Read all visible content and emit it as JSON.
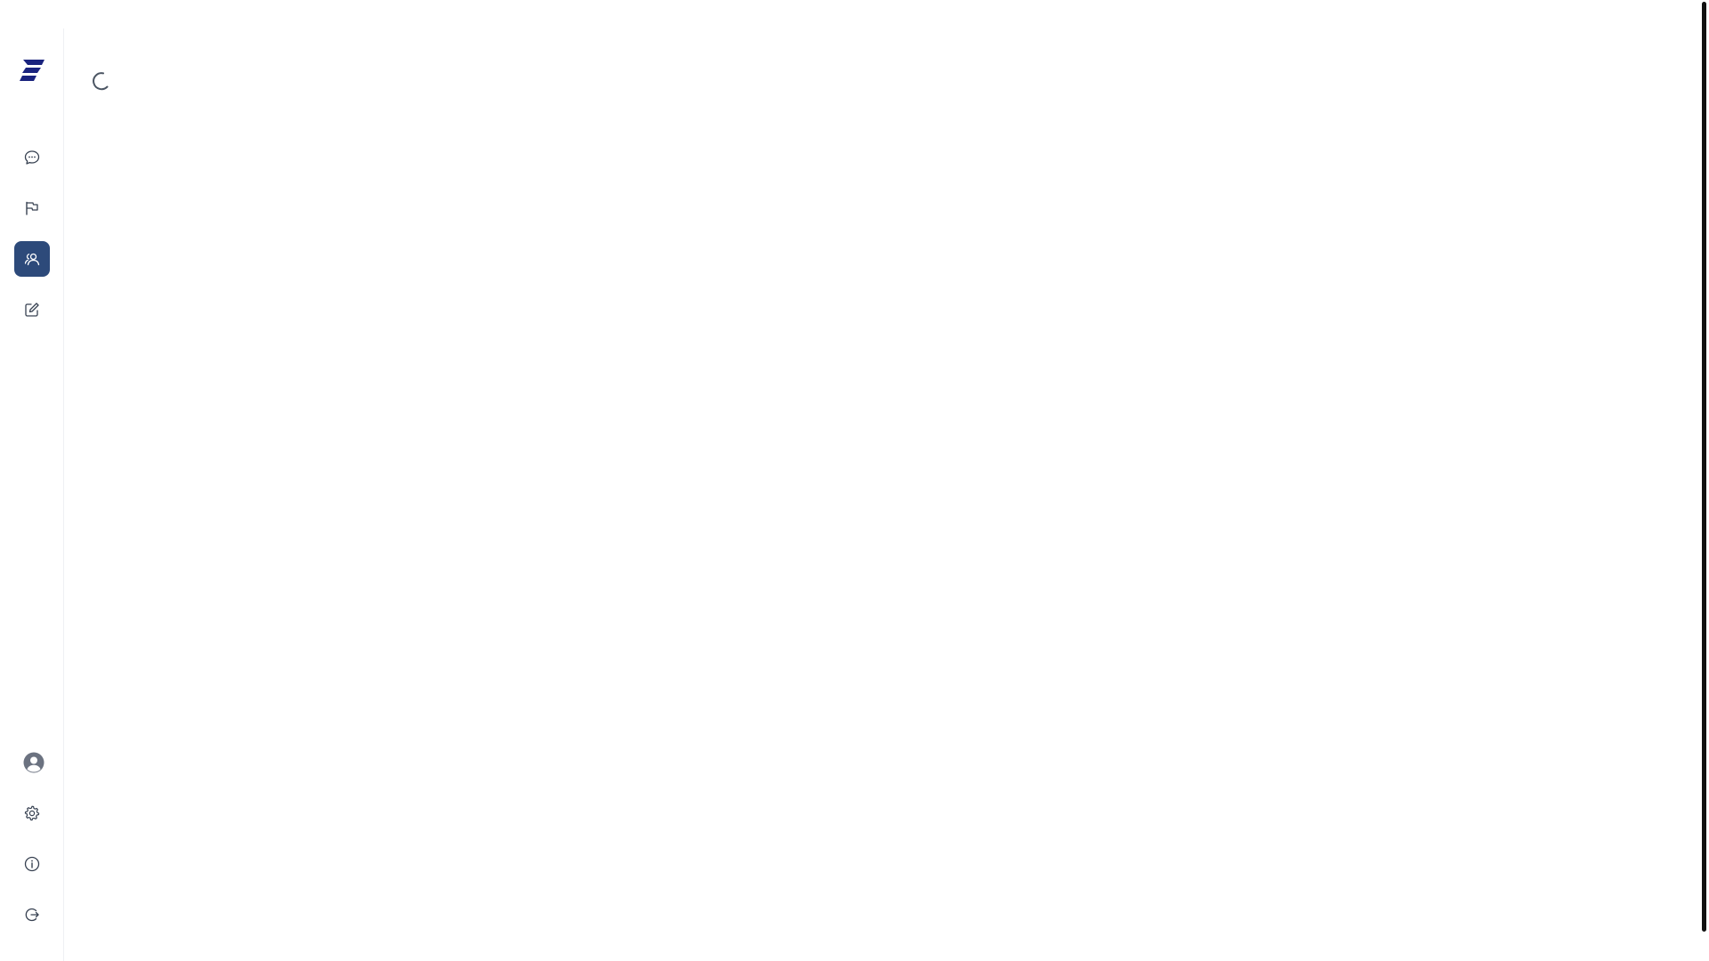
{
  "app": {
    "brand_color": "#2d4a7a",
    "logo_color": "#1a237e"
  },
  "sidebar": {
    "top_items": [
      {
        "name": "chat",
        "icon": "chat-bubble-icon",
        "active": false
      },
      {
        "name": "flag",
        "icon": "flag-icon",
        "active": false
      },
      {
        "name": "users",
        "icon": "users-icon",
        "active": true
      },
      {
        "name": "edit",
        "icon": "edit-icon",
        "active": false
      }
    ],
    "bottom_items": [
      {
        "name": "profile",
        "icon": "user-avatar-icon"
      },
      {
        "name": "settings",
        "icon": "gear-icon"
      },
      {
        "name": "info",
        "icon": "info-icon"
      },
      {
        "name": "logout",
        "icon": "logout-icon"
      }
    ]
  },
  "main": {
    "state": "loading",
    "loading_indicator": "spinner-icon"
  }
}
